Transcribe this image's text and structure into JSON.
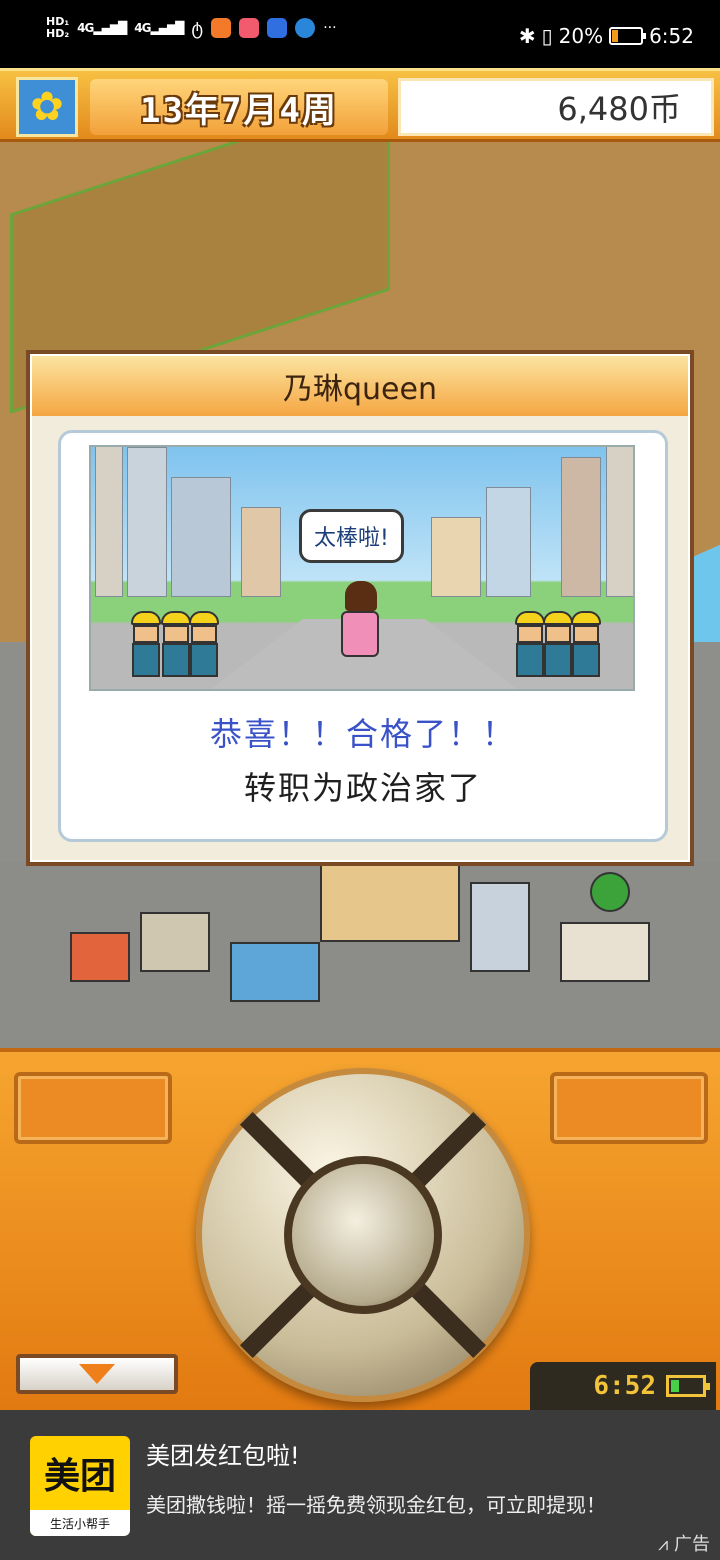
{
  "status_bar": {
    "hd_top": "HD₁",
    "hd_bottom": "HD₂",
    "signal_1": "4G",
    "signal_2": "4G",
    "more": "···",
    "battery_percent": "20%",
    "time": "6:52",
    "battery_level": 0.2
  },
  "game_header": {
    "date": "13年7月4周",
    "money": "6,480币"
  },
  "dialog": {
    "title": "乃琳queen",
    "speech": "太棒啦!",
    "message_line1": "恭喜！！合格了！！",
    "message_line2": "转职为政治家了"
  },
  "controls": {
    "clock_time": "6:52"
  },
  "ad": {
    "logo_text": "美团",
    "logo_subtext": "生活小帮手",
    "title": "美团发红包啦!",
    "description": "美团撒钱啦！摇一摇免费领现金红包，可立即提现！",
    "tag": "广告"
  },
  "colors": {
    "accent_orange": "#f39a1b",
    "dialog_blue_text": "#3a52c8"
  }
}
